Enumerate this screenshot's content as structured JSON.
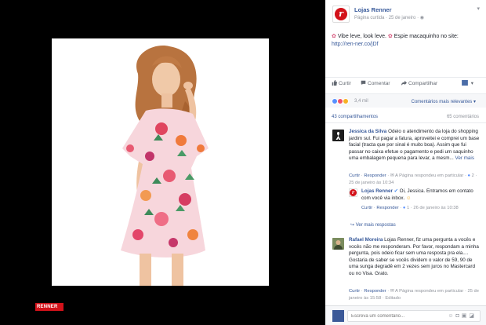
{
  "post": {
    "page_name": "Lojas Renner",
    "meta_prefix": "Página curtida",
    "date": "25 de janeiro",
    "text_1": "Vibe leve, look leve.",
    "text_2": "Espie macaquinho no site:",
    "link": "http://ren-ner.co/jDf"
  },
  "badge": {
    "label": "RENNER"
  },
  "actions": {
    "like": "Curtir",
    "comment": "Comentar",
    "share": "Compartilhar"
  },
  "reactions": {
    "count": "3,4 mil",
    "sort": "Comentários mais relevantes"
  },
  "stats": {
    "shares": "43 compartilhamentos",
    "comments": "65 comentários"
  },
  "comments": [
    {
      "author": "Jessica da Silva",
      "text": "Odeio o atendimento da loja do shopping jardim sul. Fui pagar a fatura, aproveitei e comprei um base facial (tracta que por sinal é muito boa). Assim que fui passar no caixa efetue o pagamento e pedi um saquinho uma embalagem pequena para levar, a mesm...",
      "more": "Ver mais",
      "like": "Curtir",
      "reply": "Responder",
      "page_replied": "A Página respondeu em particular",
      "likes": "2",
      "time": "25 de janeiro às 10:34"
    },
    {
      "author": "Lojas Renner",
      "text": "Oi, Jessica. Entramos em contato com você via inbox.",
      "like": "Curtir",
      "reply": "Responder",
      "likes": "1",
      "time": "26 de janeiro às 10:38"
    },
    {
      "replies_label": "Ver mais respostas"
    },
    {
      "author": "Rafael Moreira",
      "text": "Lojas Renner, fiz uma pergunta a vocês e vocês não me responderam. Por favor, respondam a minha pergunta, pois odeio ficar sem uma resposta pra ela.... Gostaria de saber se vocês dividem o valor de 59, 90 de uma sunga degradê em 2 vezes sem juros no Mastercard ou no Visa. Grato.",
      "like": "Curtir",
      "reply": "Responder",
      "page_replied": "A Página respondeu em particular",
      "time": "25 de janeiro às 15:58",
      "edited": "Editado"
    }
  ],
  "composer": {
    "placeholder": "Escreva um comentário..."
  }
}
